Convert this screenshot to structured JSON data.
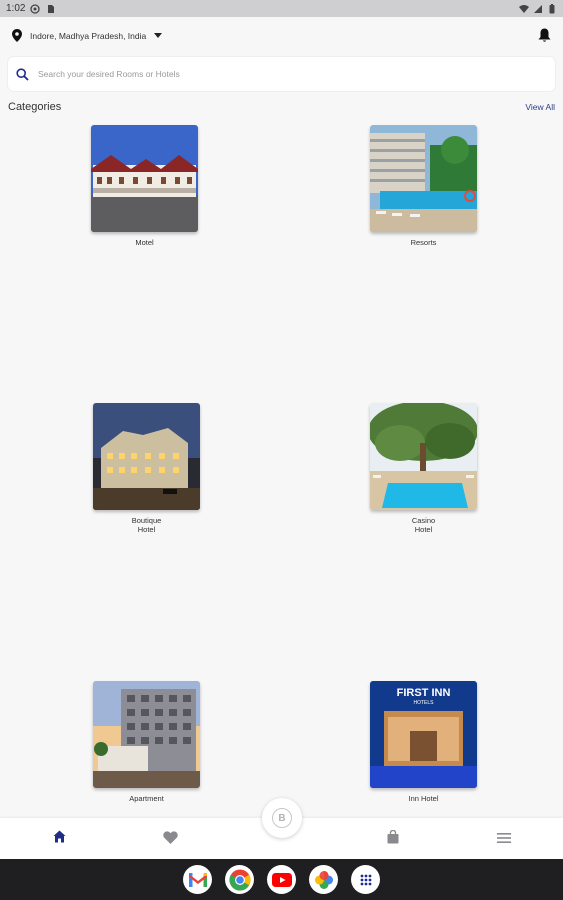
{
  "status_bar": {
    "time": "1:02"
  },
  "header": {
    "location": "Indore, Madhya Pradesh, India"
  },
  "search": {
    "placeholder": "Search your desired Rooms or Hotels"
  },
  "section": {
    "title": "Categories",
    "view_all": "View All"
  },
  "categories": [
    {
      "label": "Motel"
    },
    {
      "label": "Resorts"
    },
    {
      "label": "Boutique\nHotel"
    },
    {
      "label": "Casino\nHotel"
    },
    {
      "label": "Apartment"
    },
    {
      "label": "Inn Hotel"
    }
  ],
  "thumb_texts": {
    "inn_sign": "FIRST INN",
    "inn_sub": "HOTELS"
  },
  "bottom_nav": {
    "items": [
      {
        "icon": "home-icon",
        "active": true
      },
      {
        "icon": "heart-icon",
        "active": false
      },
      {
        "icon": "bag-icon",
        "active": false
      },
      {
        "icon": "menu-icon",
        "active": false
      }
    ],
    "fab_icon": "bitcoin-icon",
    "fab_label": "B"
  },
  "taskbar_apps": [
    "gmail-icon",
    "chrome-icon",
    "youtube-icon",
    "photos-icon",
    "apps-grid-icon"
  ],
  "colors": {
    "accent": "#1f2d8a",
    "icon_grey": "#8a8a8e",
    "link": "#2d3d87"
  }
}
